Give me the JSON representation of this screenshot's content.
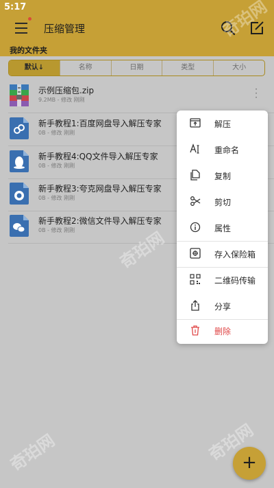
{
  "status_bar": {
    "time": "5:17"
  },
  "header": {
    "title": "压缩管理",
    "section_label": "我的文件夹"
  },
  "sort_tabs": [
    {
      "label": "默认↓",
      "active": true
    },
    {
      "label": "名称",
      "active": false
    },
    {
      "label": "日期",
      "active": false
    },
    {
      "label": "类型",
      "active": false
    },
    {
      "label": "大小",
      "active": false
    }
  ],
  "files": [
    {
      "name": "示例压缩包.zip",
      "meta": "9.2MB - 修改 刚刚",
      "icon": "zip-archive-icon"
    },
    {
      "name": "新手教程1:百度网盘导入解压专家",
      "meta": "0B - 修改 刚刚",
      "icon": "link-file-icon"
    },
    {
      "name": "新手教程4:QQ文件导入解压专家",
      "meta": "0B - 修改 刚刚",
      "icon": "qq-file-icon"
    },
    {
      "name": "新手教程3:夸克网盘导入解压专家",
      "meta": "0B - 修改 刚刚",
      "icon": "quark-file-icon"
    },
    {
      "name": "新手教程2:微信文件导入解压专家",
      "meta": "0B - 修改 刚刚",
      "icon": "wechat-file-icon"
    }
  ],
  "context_menu": [
    {
      "label": "解压",
      "icon": "extract-icon"
    },
    {
      "label": "重命名",
      "icon": "rename-icon"
    },
    {
      "label": "复制",
      "icon": "copy-icon"
    },
    {
      "label": "剪切",
      "icon": "scissors-icon"
    },
    {
      "label": "属性",
      "icon": "info-icon"
    },
    {
      "label": "存入保险箱",
      "icon": "safe-icon"
    },
    {
      "label": "二维码传输",
      "icon": "qr-code-icon"
    },
    {
      "label": "分享",
      "icon": "share-icon"
    },
    {
      "label": "删除",
      "icon": "trash-icon"
    }
  ],
  "fab": {
    "label": "+"
  },
  "watermark": "奇珀网",
  "colors": {
    "accent": "#c6a036",
    "danger": "#e04747",
    "scrim": "#c6c6c6",
    "menu_bg": "#ffffff"
  }
}
